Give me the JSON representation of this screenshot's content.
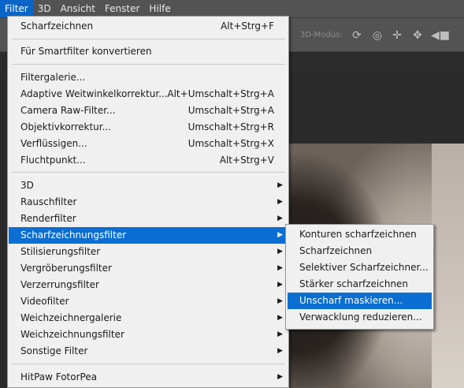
{
  "menubar": {
    "items": [
      {
        "label": "Filter",
        "active": true
      },
      {
        "label": "3D"
      },
      {
        "label": "Ansicht"
      },
      {
        "label": "Fenster"
      },
      {
        "label": "Hilfe"
      }
    ]
  },
  "options_bar": {
    "mode_label": "3D-Modus:",
    "icons": [
      "orbit-3d-icon",
      "roll-3d-icon",
      "pan-3d-icon",
      "slide-3d-icon",
      "scale-3d-icon"
    ]
  },
  "filter_menu": {
    "items": [
      {
        "label": "Scharfzeichnen",
        "shortcut": "Alt+Strg+F"
      },
      {
        "label": "Für Smartfilter konvertieren",
        "shortcut": ""
      },
      {
        "label": "Filtergalerie...",
        "shortcut": ""
      },
      {
        "label": "Adaptive Weitwinkelkorrektur...",
        "shortcut": "Alt+Umschalt+Strg+A"
      },
      {
        "label": "Camera Raw-Filter...",
        "shortcut": "Umschalt+Strg+A"
      },
      {
        "label": "Objektivkorrektur...",
        "shortcut": "Umschalt+Strg+R"
      },
      {
        "label": "Verflüssigen...",
        "shortcut": "Umschalt+Strg+X"
      },
      {
        "label": "Fluchtpunkt...",
        "shortcut": "Alt+Strg+V"
      },
      {
        "label": "3D",
        "submenu": true
      },
      {
        "label": "Rauschfilter",
        "submenu": true
      },
      {
        "label": "Renderfilter",
        "submenu": true
      },
      {
        "label": "Scharfzeichnungsfilter",
        "submenu": true,
        "active": true
      },
      {
        "label": "Stilisierungsfilter",
        "submenu": true
      },
      {
        "label": "Vergröberungsfilter",
        "submenu": true
      },
      {
        "label": "Verzerrungsfilter",
        "submenu": true
      },
      {
        "label": "Videofilter",
        "submenu": true
      },
      {
        "label": "Weichzeichnergalerie",
        "submenu": true
      },
      {
        "label": "Weichzeichnungsfilter",
        "submenu": true
      },
      {
        "label": "Sonstige Filter",
        "submenu": true
      },
      {
        "label": "HitPaw FotorPea",
        "submenu": true
      }
    ]
  },
  "sharpen_submenu": {
    "items": [
      {
        "label": "Konturen scharfzeichnen"
      },
      {
        "label": "Scharfzeichnen"
      },
      {
        "label": "Selektiver Scharfzeichner..."
      },
      {
        "label": "Stärker scharfzeichnen"
      },
      {
        "label": "Unscharf maskieren...",
        "active": true
      },
      {
        "label": "Verwacklung reduzieren..."
      }
    ]
  },
  "colors": {
    "highlight": "#0a6ed2",
    "menu_bg": "#f0f0f0",
    "app_bg": "#535353"
  }
}
